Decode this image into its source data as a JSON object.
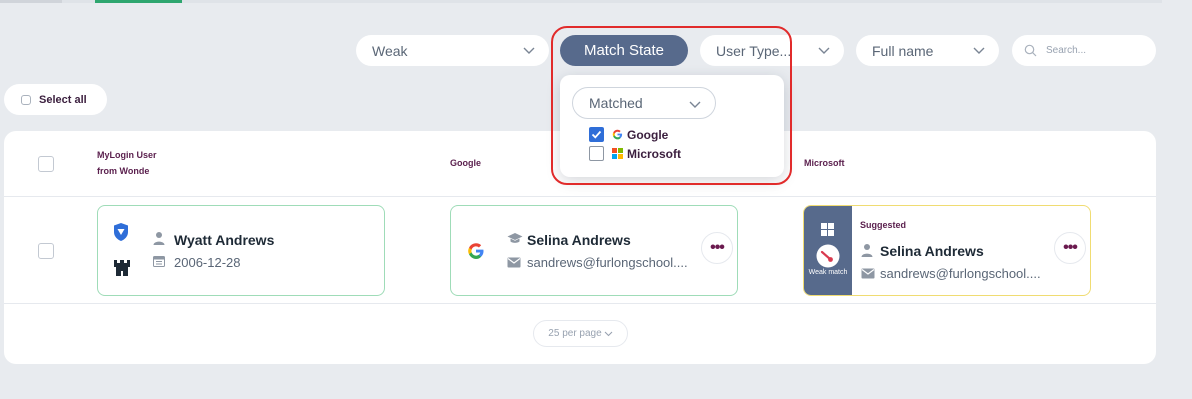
{
  "filters": {
    "strength": "Weak",
    "match_state_label": "Match State",
    "user_type": "User Type...",
    "name_field": "Full name",
    "search_placeholder": "Search..."
  },
  "select_all_label": "Select all",
  "columns": {
    "mylogin_line1": "MyLogin User",
    "mylogin_line2": "from Wonde",
    "google": "Google",
    "microsoft": "Microsoft"
  },
  "row": {
    "mylogin": {
      "name": "Wyatt Andrews",
      "date": "2006-12-28"
    },
    "google": {
      "name": "Selina Andrews",
      "email": "sandrews@furlongschool...."
    },
    "microsoft": {
      "status": "Suggested",
      "match_label": "Weak match",
      "name": "Selina Andrews",
      "email": "sandrews@furlongschool...."
    }
  },
  "match_dropdown": {
    "selected": "Matched",
    "options": [
      {
        "label": "Google",
        "checked": true
      },
      {
        "label": "Microsoft",
        "checked": false
      }
    ]
  },
  "pagination": {
    "per_page": "25 per page"
  },
  "colors": {
    "accent": "#576a8c",
    "green_border": "#9fdcb8",
    "yellow_border": "#f0dc72",
    "label_purple": "#5a1f4d",
    "highlight_red": "#e12b2b"
  }
}
